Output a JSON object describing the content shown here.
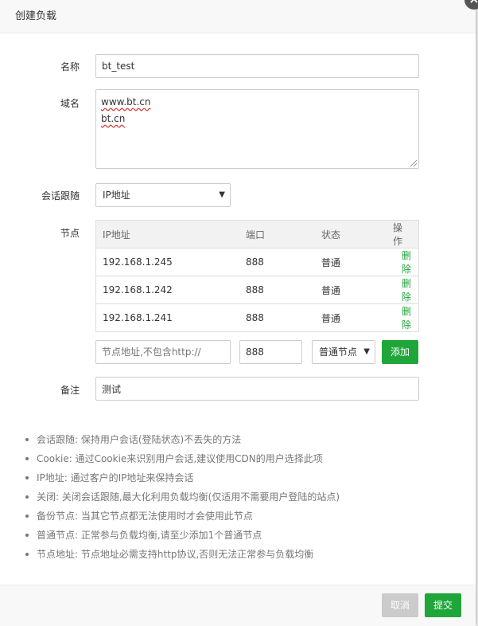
{
  "dialog": {
    "title": "创建负载"
  },
  "form": {
    "name_label": "名称",
    "name_value": "bt_test",
    "domain_label": "域名",
    "domain_lines": [
      "www.bt.cn",
      "bt.cn"
    ],
    "session_label": "会话跟随",
    "session_value": "IP地址",
    "nodes_label": "节点",
    "remark_label": "备注",
    "remark_value": "测试"
  },
  "nodes_table": {
    "headers": [
      "IP地址",
      "端口",
      "状态",
      "操作"
    ],
    "rows": [
      {
        "ip": "192.168.1.245",
        "port": "888",
        "status": "普通",
        "action": "删除"
      },
      {
        "ip": "192.168.1.242",
        "port": "888",
        "status": "普通",
        "action": "删除"
      },
      {
        "ip": "192.168.1.241",
        "port": "888",
        "status": "普通",
        "action": "删除"
      }
    ]
  },
  "add_node": {
    "address_placeholder": "节点地址,不包含http://",
    "port_value": "888",
    "type_value": "普通节点",
    "add_label": "添加"
  },
  "tips": [
    "会话跟随: 保持用户会话(登陆状态)不丢失的方法",
    "Cookie: 通过Cookie来识别用户会话,建议使用CDN的用户选择此项",
    "IP地址: 通过客户的IP地址来保持会话",
    "关闭: 关闭会话跟随,最大化利用负载均衡(仅适用不需要用户登陆的站点)",
    "备份节点: 当其它节点都无法使用时才会使用此节点",
    "普通节点: 正常参与负载均衡,请至少添加1个普通节点",
    "节点地址: 节点地址必需支持http协议,否则无法正常参与负载均衡"
  ],
  "footer": {
    "cancel_label": "取消",
    "submit_label": "提交"
  },
  "icons": {
    "close": "close-icon",
    "select_caret": "caret-down-icon"
  },
  "colors": {
    "accent": "#20a53a",
    "cancel": "#cbcbcb"
  }
}
